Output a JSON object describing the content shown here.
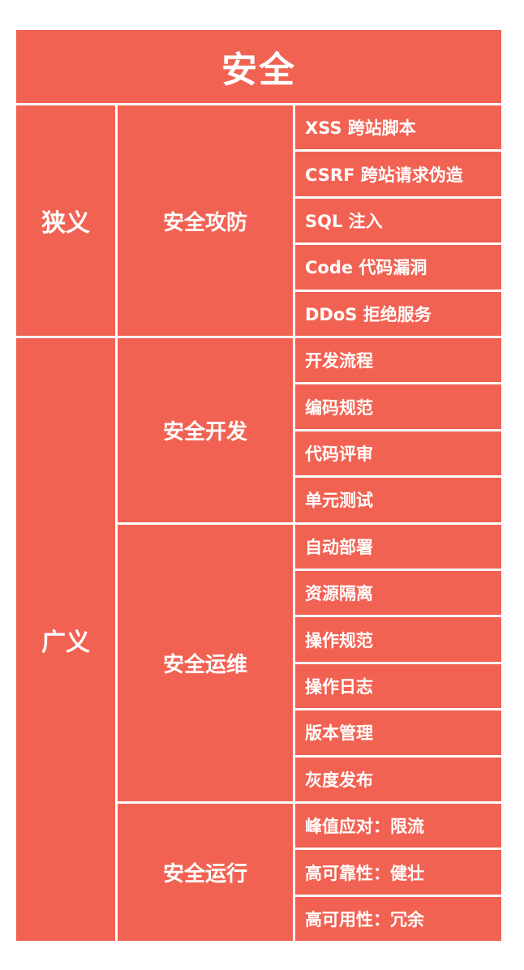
{
  "title": "安全",
  "groups": [
    {
      "scope": "狭义",
      "areas": [
        {
          "name": "安全攻防",
          "items": [
            "XSS 跨站脚本",
            "CSRF 跨站请求伪造",
            "SQL 注入",
            "Code 代码漏洞",
            "DDoS 拒绝服务"
          ]
        }
      ]
    },
    {
      "scope": "广义",
      "areas": [
        {
          "name": "安全开发",
          "items": [
            "开发流程",
            "编码规范",
            "代码评审",
            "单元测试"
          ]
        },
        {
          "name": "安全运维",
          "items": [
            "自动部署",
            "资源隔离",
            "操作规范",
            "操作日志",
            "版本管理",
            "灰度发布"
          ]
        },
        {
          "name": "安全运行",
          "items": [
            "峰值应对：限流",
            "高可靠性：健壮",
            "高可用性：冗余"
          ]
        }
      ]
    }
  ],
  "colors": {
    "cell": "#f26252",
    "text": "#ffffff",
    "divider": "#ffffff"
  }
}
